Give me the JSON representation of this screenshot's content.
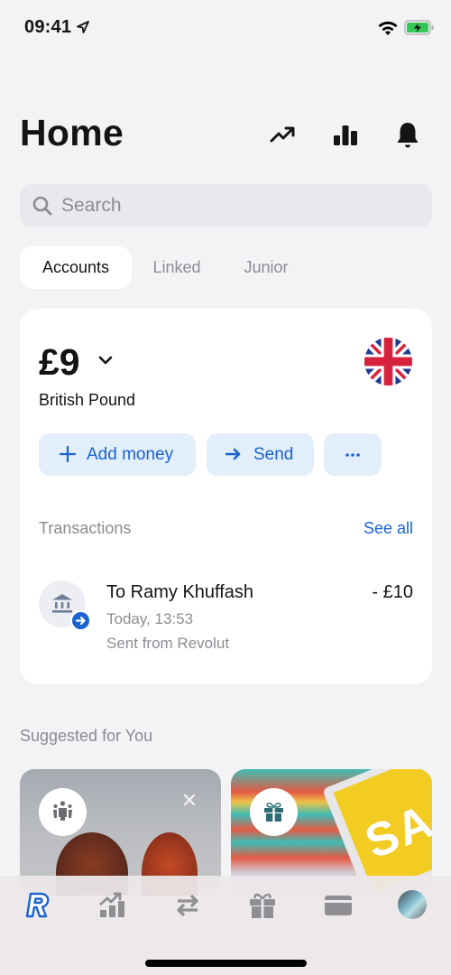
{
  "status_bar": {
    "time": "09:41",
    "icons": [
      "location-arrow-icon",
      "wifi-icon",
      "battery-charging-icon"
    ]
  },
  "header": {
    "title": "Home",
    "actions": [
      {
        "name": "trend-icon",
        "label": "Trending"
      },
      {
        "name": "stats-icon",
        "label": "Analytics"
      },
      {
        "name": "bell-icon",
        "label": "Notifications"
      }
    ]
  },
  "search": {
    "placeholder": "Search",
    "value": ""
  },
  "tabs": [
    {
      "label": "Accounts",
      "active": true
    },
    {
      "label": "Linked",
      "active": false
    },
    {
      "label": "Junior",
      "active": false
    }
  ],
  "account": {
    "balance": "£9",
    "currency_name": "British Pound",
    "flag": "uk-flag-icon",
    "actions": [
      {
        "label": "Add money",
        "icon": "plus-icon"
      },
      {
        "label": "Send",
        "icon": "arrow-right-icon"
      },
      {
        "label": "",
        "icon": "more-icon"
      }
    ],
    "transactions_header": "Transactions",
    "see_all": "See all",
    "transactions": [
      {
        "title": "To Ramy Khuffash",
        "amount": "- £10",
        "time": "Today, 13:53",
        "subtitle": "Sent from Revolut",
        "icon": "bank-icon"
      }
    ]
  },
  "suggested": {
    "title": "Suggested for You",
    "cards": [
      {
        "icon": "friends-icon",
        "dismissible": true
      },
      {
        "icon": "gift-icon",
        "image_text": "SA"
      }
    ]
  },
  "bottom_nav": [
    {
      "name": "home",
      "icon": "revolut-logo-icon",
      "active": true
    },
    {
      "name": "invest",
      "icon": "invest-chart-icon",
      "active": false
    },
    {
      "name": "transfer",
      "icon": "transfer-arrows-icon",
      "active": false
    },
    {
      "name": "rewards",
      "icon": "gift-icon",
      "active": false
    },
    {
      "name": "cards",
      "icon": "card-icon",
      "active": false
    },
    {
      "name": "profile",
      "icon": "profile-avatar",
      "active": false
    }
  ],
  "colors": {
    "accent": "#1a63d1",
    "button_bg": "#e3eefb",
    "background": "#f3f3f6",
    "muted_text": "#8c8c94"
  }
}
